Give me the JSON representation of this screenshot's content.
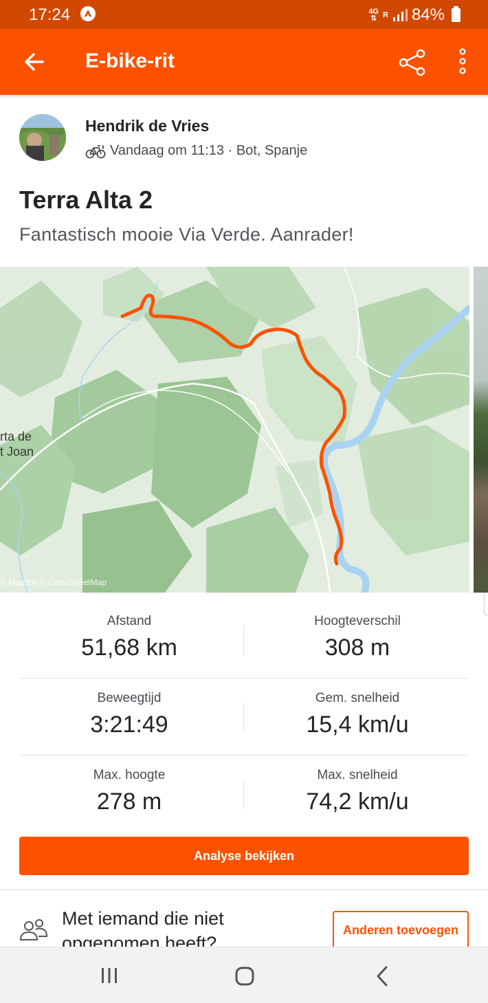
{
  "status_bar": {
    "time": "17:24",
    "network_top": "4G",
    "network_bottom": "R",
    "battery": "84%"
  },
  "app_bar": {
    "title": "E-bike-rit"
  },
  "athlete": {
    "name": "Hendrik de Vries",
    "meta": "Vandaag om 11:13 · Bot, Spanje"
  },
  "activity": {
    "title": "Terra Alta 2",
    "description": "Fantastisch mooie Via Verde. Aanrader!"
  },
  "map": {
    "town_line1": "rta de",
    "town_line2": "t Joan",
    "attribution": "© Mapbox © OpenStreetMap",
    "route_color": "#fc5200",
    "water_color": "#a9d3f0"
  },
  "stats": [
    {
      "label": "Afstand",
      "value": "51,68 km"
    },
    {
      "label": "Hoogteverschil",
      "value": "308 m"
    },
    {
      "label": "Beweegtijd",
      "value": "3:21:49"
    },
    {
      "label": "Gem. snelheid",
      "value": "15,4 km/u"
    },
    {
      "label": "Max. hoogte",
      "value": "278 m"
    },
    {
      "label": "Max. snelheid",
      "value": "74,2 km/u"
    }
  ],
  "analyse_button": "Analyse bekijken",
  "invite": {
    "text_line1": "Met iemand die niet",
    "text_line2": "opgenomen heeft?",
    "button": "Anderen toevoegen"
  },
  "icons": {
    "back": "arrow-left-icon",
    "share": "share-icon",
    "more": "more-vertical-icon",
    "ride": "bicycle-icon",
    "invite": "people-icon",
    "nav_recent": "recent-apps-icon",
    "nav_home": "home-icon",
    "nav_back": "chevron-left-icon"
  },
  "colors": {
    "brand": "#fc5200",
    "status_bar": "#d14800"
  }
}
